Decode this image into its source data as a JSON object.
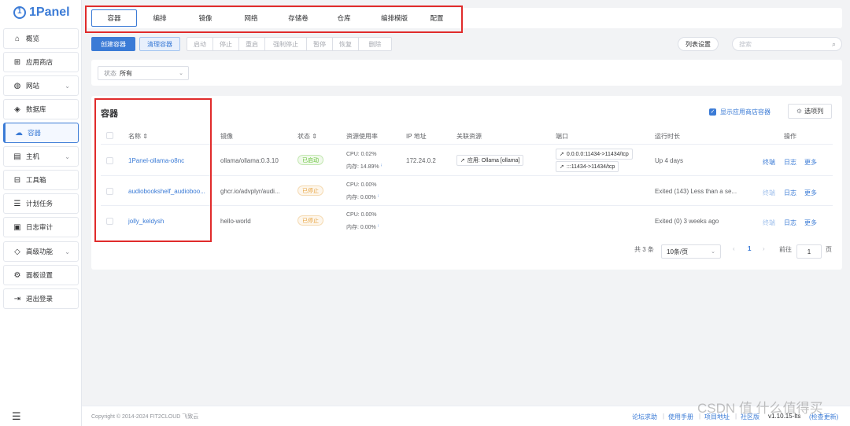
{
  "app": {
    "logo": "1Panel"
  },
  "sidebar": {
    "items": [
      {
        "label": "概览",
        "icon": "home-icon"
      },
      {
        "label": "应用商店",
        "icon": "grid-icon"
      },
      {
        "label": "网站",
        "icon": "globe-icon"
      },
      {
        "label": "数据库",
        "icon": "database-icon"
      },
      {
        "label": "容器",
        "icon": "docker-icon"
      },
      {
        "label": "主机",
        "icon": "server-icon"
      },
      {
        "label": "工具箱",
        "icon": "toolbox-icon"
      },
      {
        "label": "计划任务",
        "icon": "task-icon"
      },
      {
        "label": "日志审计",
        "icon": "log-icon"
      },
      {
        "label": "高级功能",
        "icon": "diamond-icon"
      },
      {
        "label": "面板设置",
        "icon": "gear-icon"
      },
      {
        "label": "退出登录",
        "icon": "logout-icon"
      }
    ]
  },
  "tabs": [
    "容器",
    "编排",
    "镜像",
    "网络",
    "存储卷",
    "仓库",
    "编排模版",
    "配置"
  ],
  "toolbar": {
    "create": "创建容器",
    "clean": "清理容器",
    "start": "启动",
    "stop": "停止",
    "restart": "重启",
    "force_stop": "强制停止",
    "pause": "暂停",
    "resume": "恢复",
    "delete": "删除",
    "list_settings": "列表设置",
    "search_placeholder": "搜索"
  },
  "filter": {
    "label": "状态",
    "value": "所有"
  },
  "panel": {
    "title": "容器",
    "show_appstore": "显示应用商店容器",
    "column_options": "选项列"
  },
  "table": {
    "headers": {
      "name": "名称 ⇕",
      "image": "镜像",
      "status": "状态 ⇕",
      "usage": "资源使用率",
      "ip": "IP 地址",
      "related": "关联资源",
      "port": "端口",
      "uptime": "运行时长",
      "actions": "操作"
    },
    "rows": [
      {
        "name": "1Panel-ollama-o8nc",
        "image": "ollama/ollama:0.3.10",
        "status": "已启动",
        "cpu": "CPU: 0.02%",
        "mem": "内存: 14.89%",
        "ip": "172.24.0.2",
        "related": "应用: Ollama [ollama]",
        "port1": "0.0.0.0:11434->11434/tcp",
        "port2": ":::11434->11434/tcp",
        "uptime": "Up 4 days",
        "terminal": "终端",
        "logs": "日志",
        "more": "更多"
      },
      {
        "name": "audiobookshelf_audioboo...",
        "image": "ghcr.io/advplyr/audi...",
        "status": "已停止",
        "cpu": "CPU: 0.00%",
        "mem": "内存: 0.00%",
        "uptime": "Exited (143) Less than a se...",
        "terminal": "终端",
        "logs": "日志",
        "more": "更多"
      },
      {
        "name": "jolly_keldysh",
        "image": "hello-world",
        "status": "已停止",
        "cpu": "CPU: 0.00%",
        "mem": "内存: 0.00%",
        "uptime": "Exited (0) 3 weeks ago",
        "terminal": "终端",
        "logs": "日志",
        "more": "更多"
      }
    ]
  },
  "pagination": {
    "total": "共 3 条",
    "page_size": "10条/页",
    "prev": "‹",
    "current": "1",
    "next": "›",
    "goto": "前往",
    "goto_value": "1",
    "page_suffix": "页"
  },
  "footer": {
    "copyright": "Copyright © 2014-2024 FIT2CLOUD 飞致云",
    "forum": "论坛求助",
    "manual": "使用手册",
    "project": "项目地址",
    "community": "社区版",
    "version": "v1.10.15-lts",
    "check_update": "(检查更新)"
  },
  "watermark": "CSDN 值 什么值得买"
}
